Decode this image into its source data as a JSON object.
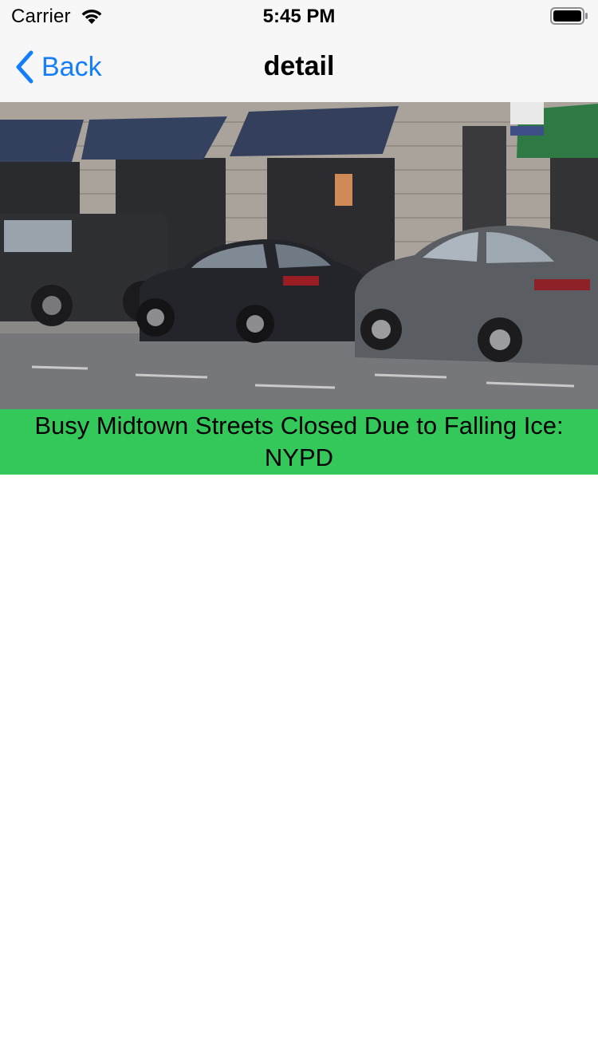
{
  "status_bar": {
    "carrier": "Carrier",
    "time": "5:45 PM",
    "wifi_icon": "wifi-icon",
    "battery_icon": "battery-icon"
  },
  "nav_bar": {
    "back_label": "Back",
    "back_icon": "chevron-left-icon",
    "title": "detail",
    "accent_color": "#147efb"
  },
  "article": {
    "image_description_icon": "street-photo",
    "headline": "Busy Midtown Streets Closed Due to Falling Ice: NYPD",
    "headline_background": "#34c759"
  }
}
